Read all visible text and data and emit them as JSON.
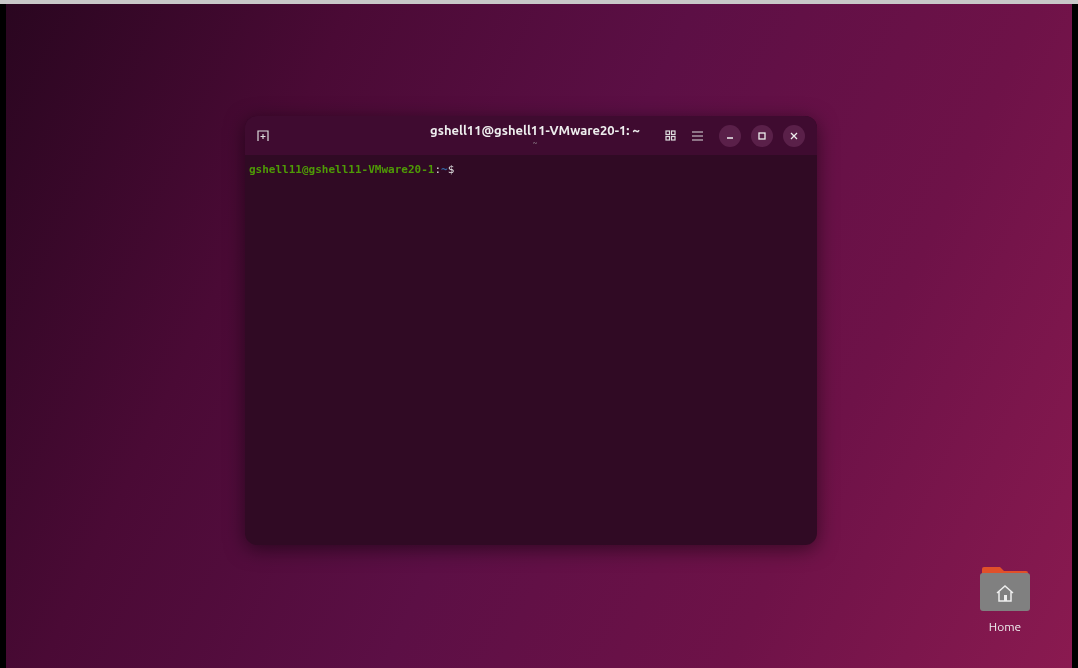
{
  "terminal": {
    "title": "gshell11@gshell11-VMware20-1: ~",
    "subtitle": "~",
    "prompt": {
      "user_host": "gshell11@gshell11-VMware20-1",
      "separator": ":",
      "path": "~",
      "symbol": "$"
    }
  },
  "desktop_icons": [
    {
      "label": "Home"
    }
  ]
}
